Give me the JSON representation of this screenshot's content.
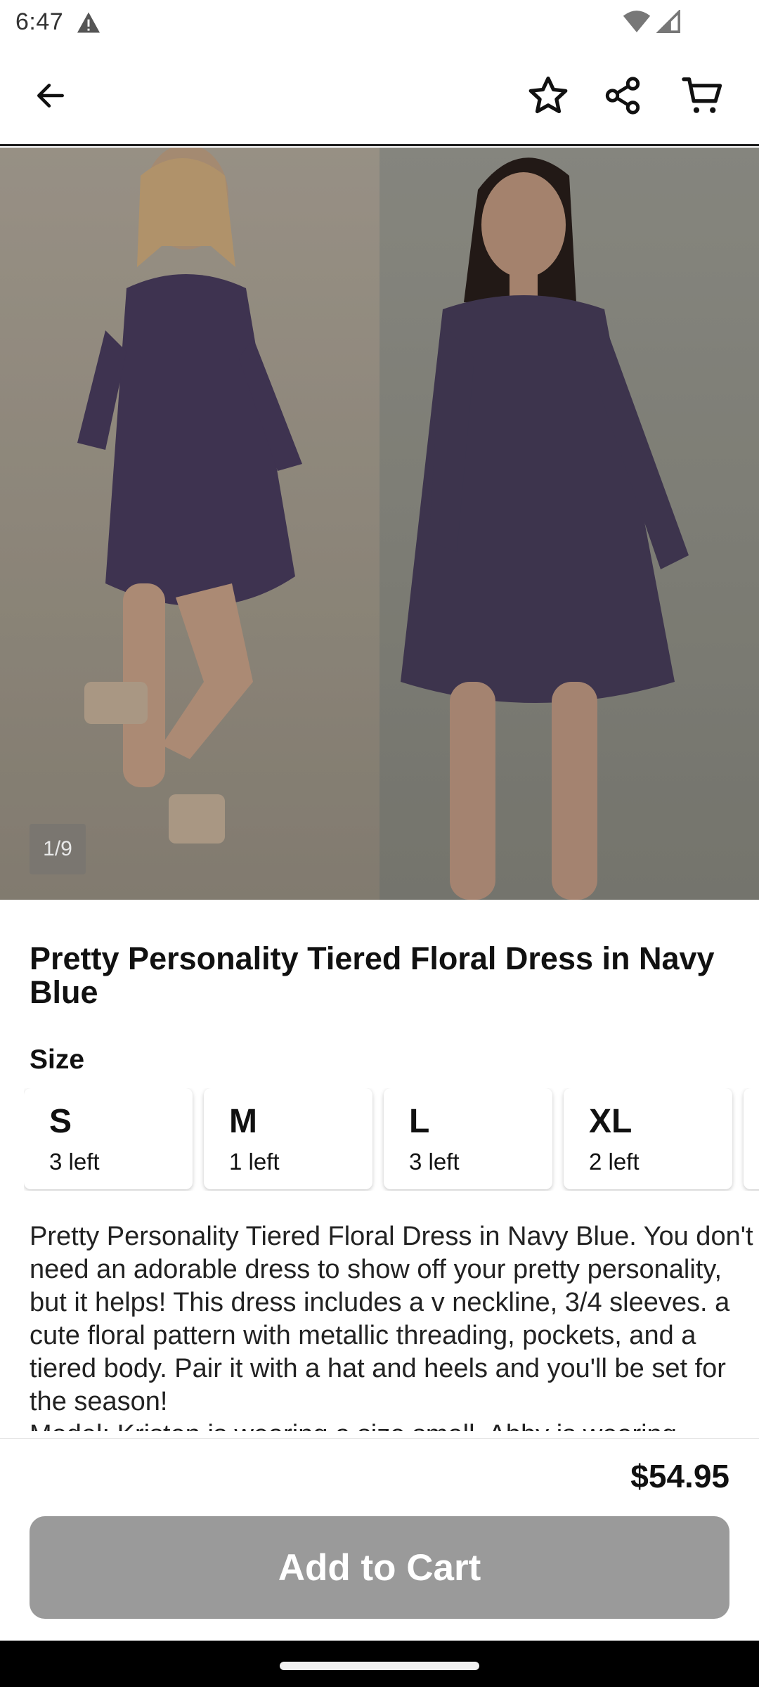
{
  "status_bar": {
    "time": "6:47"
  },
  "app_bar": {
    "icons": [
      "back-arrow-icon",
      "star-icon",
      "share-icon",
      "cart-icon"
    ]
  },
  "gallery": {
    "page_indicator": "1/9"
  },
  "product": {
    "title": "Pretty Personality Tiered Floral Dress in Navy Blue",
    "size_label": "Size",
    "sizes": [
      {
        "name": "S",
        "stock": "3 left"
      },
      {
        "name": "M",
        "stock": "1 left"
      },
      {
        "name": "L",
        "stock": "3 left"
      },
      {
        "name": "XL",
        "stock": "2 left"
      }
    ],
    "description": "Pretty Personality Tiered Floral Dress in Navy Blue. You don't need an adorable dress to show off your pretty personality, but it helps! This dress includes a v neckline, 3/4 sleeves. a cute floral pattern with metallic threading, pockets, and a tiered body. Pair it with a hat and heels and you'll be set for the season!",
    "description_more": "Model: Kristen is wearing a size small. Abby is wearing"
  },
  "purchase": {
    "price": "$54.95",
    "add_to_cart_label": "Add to Cart",
    "button_color": "#9a9a9a"
  }
}
